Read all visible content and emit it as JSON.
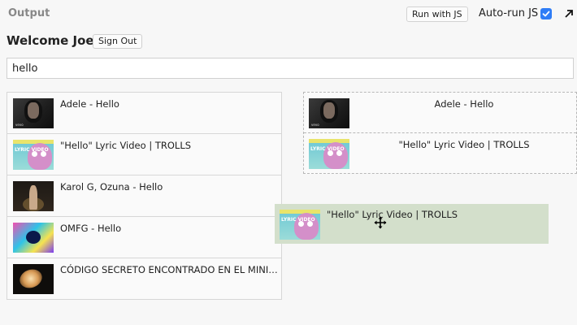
{
  "header": {
    "title": "Output",
    "run_label": "Run with JS",
    "autorun_label": "Auto-run JS",
    "autorun_checked": true
  },
  "user": {
    "welcome": "Welcome Joel!",
    "signout_label": "Sign Out"
  },
  "search": {
    "value": "hello"
  },
  "results": [
    {
      "title": "Adele - Hello",
      "thumb": "adele-thumbnail"
    },
    {
      "title": "\"Hello\" Lyric Video | TROLLS",
      "thumb": "trolls-thumbnail"
    },
    {
      "title": "Karol G, Ozuna - Hello",
      "thumb": "karol-thumbnail"
    },
    {
      "title": "OMFG - Hello",
      "thumb": "omfg-thumbnail"
    },
    {
      "title": "CÓDIGO SECRETO ENCONTRADO EN EL MINIJUEGO",
      "thumb": "codigo-thumbnail"
    }
  ],
  "dropped": [
    {
      "title": "Adele - Hello",
      "thumb": "adele-thumbnail"
    },
    {
      "title": "\"Hello\" Lyric Video | TROLLS",
      "thumb": "trolls-thumbnail"
    }
  ],
  "dragging": {
    "title": "\"Hello\" Lyric Video | TROLLS",
    "thumb": "trolls-thumbnail"
  },
  "thumb_text": {
    "adele_tag": "vevo",
    "trolls_lines": "LYRIC VIDEO"
  },
  "colors": {
    "accent": "#2f7df6",
    "drag_ghost": "#d3dfcb",
    "border": "#d7d7d7"
  },
  "icons": {
    "checkbox": "checkmark-icon",
    "expand": "expand-arrow-icon",
    "cursor": "move-cursor-icon"
  }
}
